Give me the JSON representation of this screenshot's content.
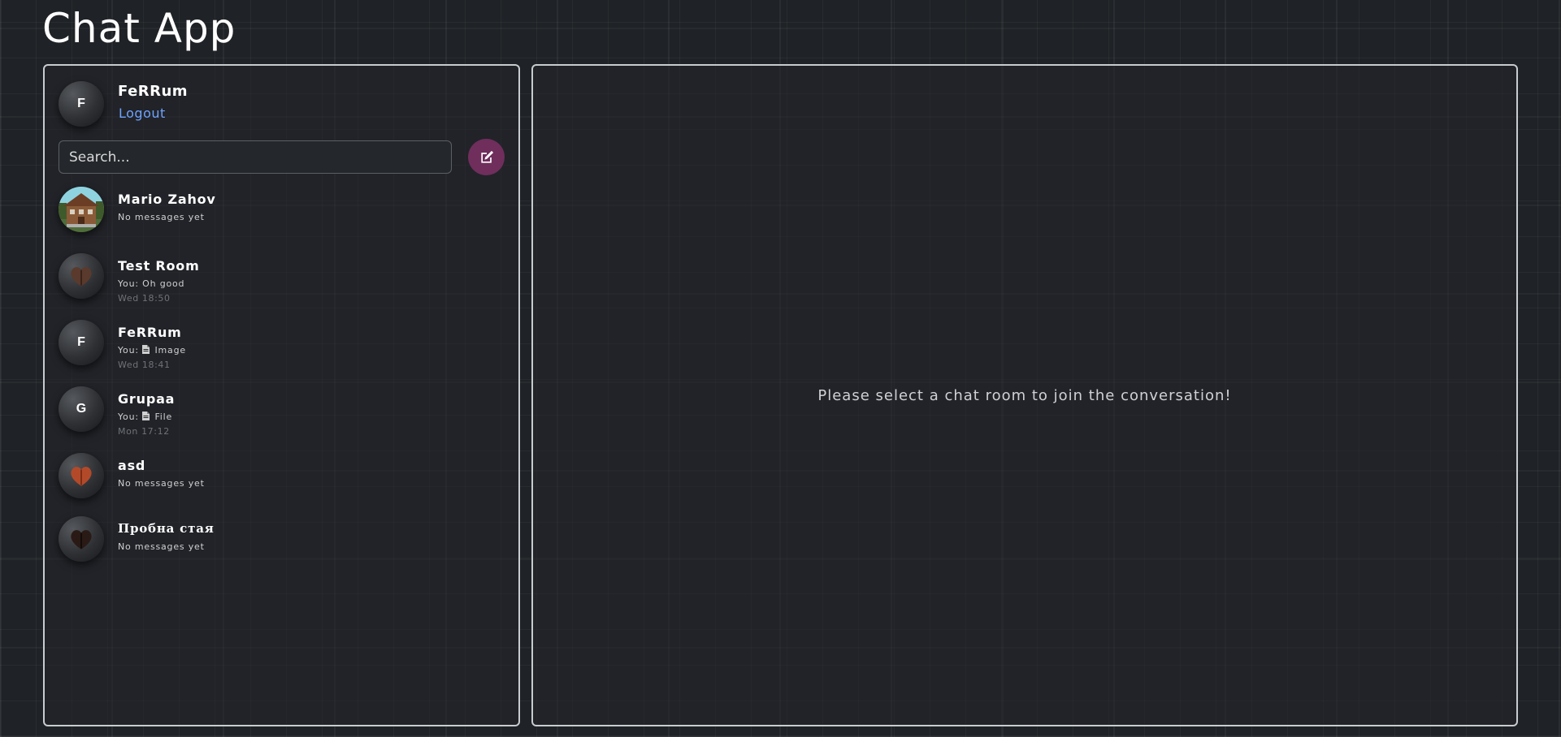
{
  "app": {
    "title": "Chat App"
  },
  "current_user": {
    "name": "FeRRum",
    "initial": "F",
    "logout_label": "Logout"
  },
  "search": {
    "placeholder": "Search..."
  },
  "compose": {
    "icon": "edit-icon",
    "color": "#6f2e5c"
  },
  "rooms": [
    {
      "name": "Mario Zahov",
      "avatar": "house-photo",
      "preview": "No messages yet",
      "time": ""
    },
    {
      "name": "Test Room",
      "avatar": "heart-brown",
      "preview": "You: Oh good",
      "time": "Wed 18:50"
    },
    {
      "name": "FeRRum",
      "avatar_initial": "F",
      "preview_prefix": "You:",
      "preview_icon": "file-icon",
      "preview_text": "Image",
      "time": "Wed 18:41"
    },
    {
      "name": "Grupaa",
      "avatar_initial": "G",
      "preview_prefix": "You:",
      "preview_icon": "file-icon",
      "preview_text": "File",
      "time": "Mon 17:12"
    },
    {
      "name": "asd",
      "avatar": "heart-orange",
      "preview": "No messages yet",
      "time": ""
    },
    {
      "name": "Пробна стая",
      "avatar": "heart-dark",
      "preview": "No messages yet",
      "time": ""
    }
  ],
  "chat_area": {
    "placeholder": "Please select a chat room to join the conversation!"
  },
  "colors": {
    "background": "#1f2226",
    "panel_border": "#c9cccf",
    "link": "#6fa3ff",
    "accent": "#6f2e5c",
    "muted_text": "#6f7276"
  }
}
